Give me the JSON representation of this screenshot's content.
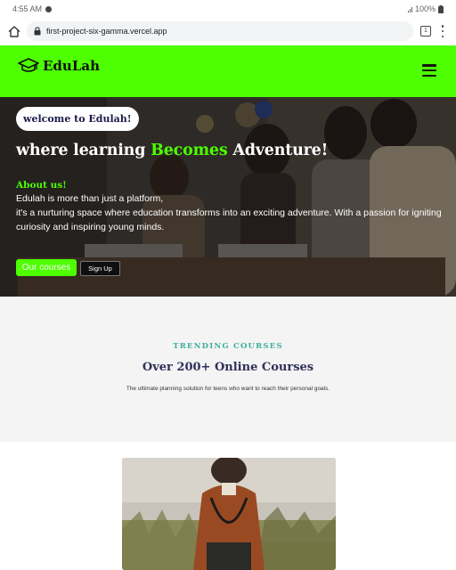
{
  "status": {
    "time": "4:55 AM",
    "battery": "100%"
  },
  "browser": {
    "url": "first-project-six-gamma.vercel.app",
    "tab_count": "1"
  },
  "site": {
    "brand": "EduLah"
  },
  "hero": {
    "welcome": "welcome to Edulah!",
    "title_before": "where learning ",
    "title_accent": "Becomes",
    "title_after": " Adventure!",
    "about_heading": "About us!",
    "about_line1": "Edulah is more than just a platform,",
    "about_line2": "it's a nurturing space where education transforms into an exciting adventure. With a passion for igniting curiosity and inspiring young minds.",
    "primary_button": "Our courses",
    "secondary_button": "Sign Up"
  },
  "trending": {
    "eyebrow": "TRENDING COURSES",
    "title": "Over 200+ Online Courses",
    "subtitle": "The ultimate planning solution for teens who want to reach their personal goals."
  },
  "colors": {
    "brand_green": "#4dff00",
    "teal": "#3fae9d",
    "navy": "#30305a"
  }
}
